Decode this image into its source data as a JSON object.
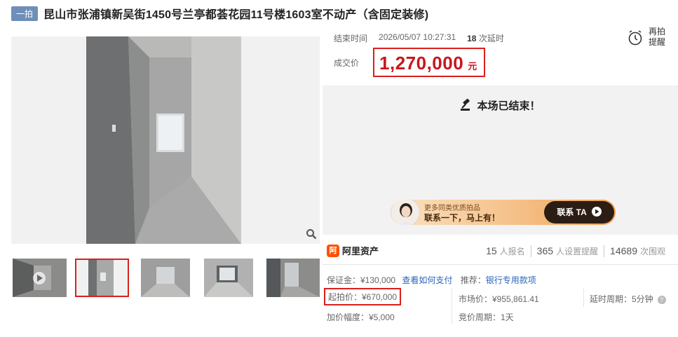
{
  "header": {
    "badge": "一拍",
    "title": "昆山市张浦镇新吴街1450号兰亭都荟花园11号楼1603室不动产（含固定装修)"
  },
  "auction": {
    "end_label": "结束时间",
    "end_time": "2026/05/07 10:27:31",
    "delay_count": "18",
    "delay_label": "次延时",
    "remind_label": "再拍提醒",
    "price_label": "成交价",
    "price_value": "1,270,000",
    "price_unit": "元",
    "ended_text": "本场已结束！"
  },
  "promo": {
    "small_text": "更多同类优质拍品",
    "big_text": "联系一下，马上有！",
    "button_label": "联系 TA"
  },
  "platform": {
    "logo_mark": "阿",
    "logo_text": "阿里资产"
  },
  "stats": [
    {
      "number": "15",
      "label": "人报名"
    },
    {
      "number": "365",
      "label": "人设置提醒"
    },
    {
      "number": "14689",
      "label": "次围观"
    }
  ],
  "details": {
    "deposit_label": "保证金：¥130,000",
    "deposit_link": "查看如何支付",
    "recommend_label": "推荐：",
    "recommend_link": "银行专用款项",
    "start_price": "起拍价：¥670,000",
    "increment": "加价幅度：¥5,000",
    "market_price": "市场价：¥955,861.41",
    "bid_cycle": "竞价周期：1天",
    "delay_cycle": "延时周期：5分钟"
  },
  "icons": {
    "zoom": "magnifier-icon",
    "remind": "alarm-clock-icon",
    "gavel": "gavel-icon",
    "help": "question-icon",
    "arrow": "play-arrow-icon"
  },
  "colors": {
    "accent_red": "#d9201c",
    "badge_blue": "#6f8fb8",
    "link_blue": "#2a63b8",
    "ali_orange": "#ff5000"
  }
}
